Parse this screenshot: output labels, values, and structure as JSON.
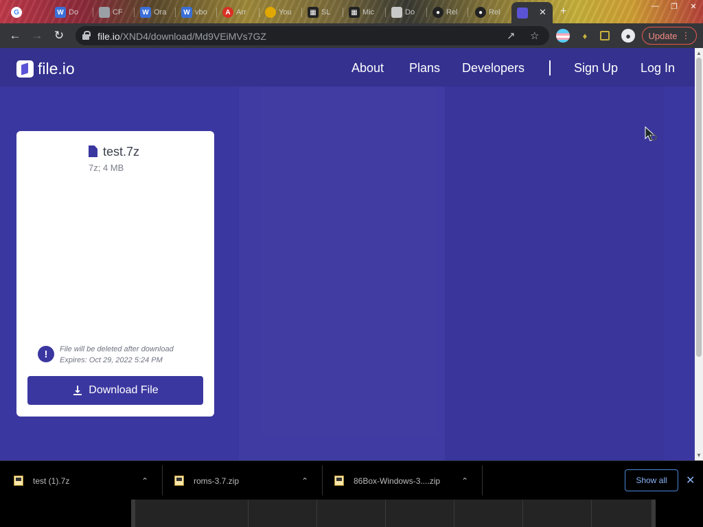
{
  "browser": {
    "tabs": [
      {
        "label": "Do",
        "color": "#3a6fd8"
      },
      {
        "label": "CF",
        "color": "#9aa0a6"
      },
      {
        "label": "Ora",
        "color": "#3a6fd8"
      },
      {
        "label": "vbo",
        "color": "#3a6fd8"
      },
      {
        "label": "Arr",
        "color": "#d93025"
      },
      {
        "label": "You",
        "color": "#e0a800"
      },
      {
        "label": "SL",
        "color": "#222222"
      },
      {
        "label": "Mic",
        "color": "#222222"
      },
      {
        "label": "Do",
        "color": "#c8c8c8"
      },
      {
        "label": "Rel",
        "color": "#222222"
      },
      {
        "label": "Rel",
        "color": "#222222"
      }
    ],
    "address": {
      "host": "file.io",
      "path": "/XND4/download/Md9VEiMVs7GZ"
    },
    "update_label": "Update"
  },
  "site": {
    "logo_text": "file.io",
    "nav": {
      "about": "About",
      "plans": "Plans",
      "developers": "Developers",
      "sign_up": "Sign Up",
      "log_in": "Log In"
    }
  },
  "file": {
    "name": "test.7z",
    "meta": "7z; 4 MB",
    "delete_notice": "File will be deleted after download",
    "expires": "Expires: Oct 29, 2022 5:24 PM",
    "download_label": "Download File"
  },
  "downloads": {
    "items": [
      "test (1).7z",
      "roms-3.7.zip",
      "86Box-Windows-3....zip"
    ],
    "show_all": "Show all"
  },
  "colors": {
    "page_bg": "#3b37a0",
    "header_bg": "#34318f",
    "accent": "#3b37a0",
    "update_border": "#e85a50"
  }
}
